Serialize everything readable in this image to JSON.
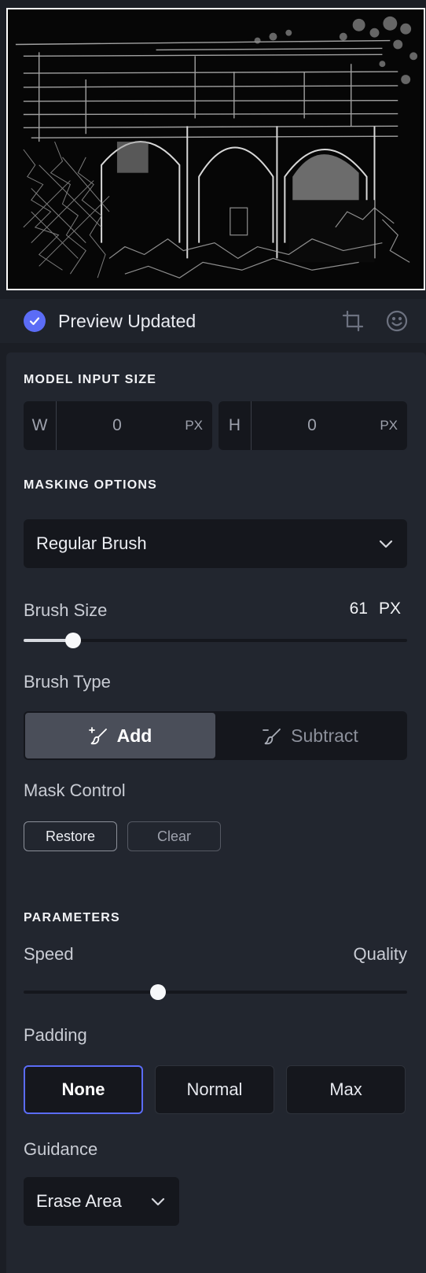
{
  "status": {
    "text": "Preview Updated",
    "accent_color": "#5b6cf6",
    "icons": [
      "check-icon",
      "crop-icon",
      "smiley-icon"
    ]
  },
  "model_input": {
    "heading": "MODEL INPUT SIZE",
    "width": {
      "prefix": "W",
      "value": "0",
      "unit": "PX"
    },
    "height": {
      "prefix": "H",
      "value": "0",
      "unit": "PX"
    }
  },
  "masking": {
    "heading": "MASKING OPTIONS",
    "mode_selected": "Regular Brush",
    "brush_size_label": "Brush Size",
    "brush_size_value": "61",
    "brush_size_unit": "PX",
    "brush_size_fraction": 0.13,
    "brush_type_label": "Brush Type",
    "brush_type_options": [
      "Add",
      "Subtract"
    ],
    "brush_type_selected": "Add",
    "mask_control_label": "Mask Control",
    "restore_label": "Restore",
    "clear_label": "Clear"
  },
  "parameters": {
    "heading": "PARAMETERS",
    "speed_label": "Speed",
    "quality_label": "Quality",
    "speed_quality_fraction": 0.35,
    "padding_label": "Padding",
    "padding_options": [
      "None",
      "Normal",
      "Max"
    ],
    "padding_selected": "None",
    "guidance_label": "Guidance",
    "guidance_selected": "Erase Area"
  }
}
